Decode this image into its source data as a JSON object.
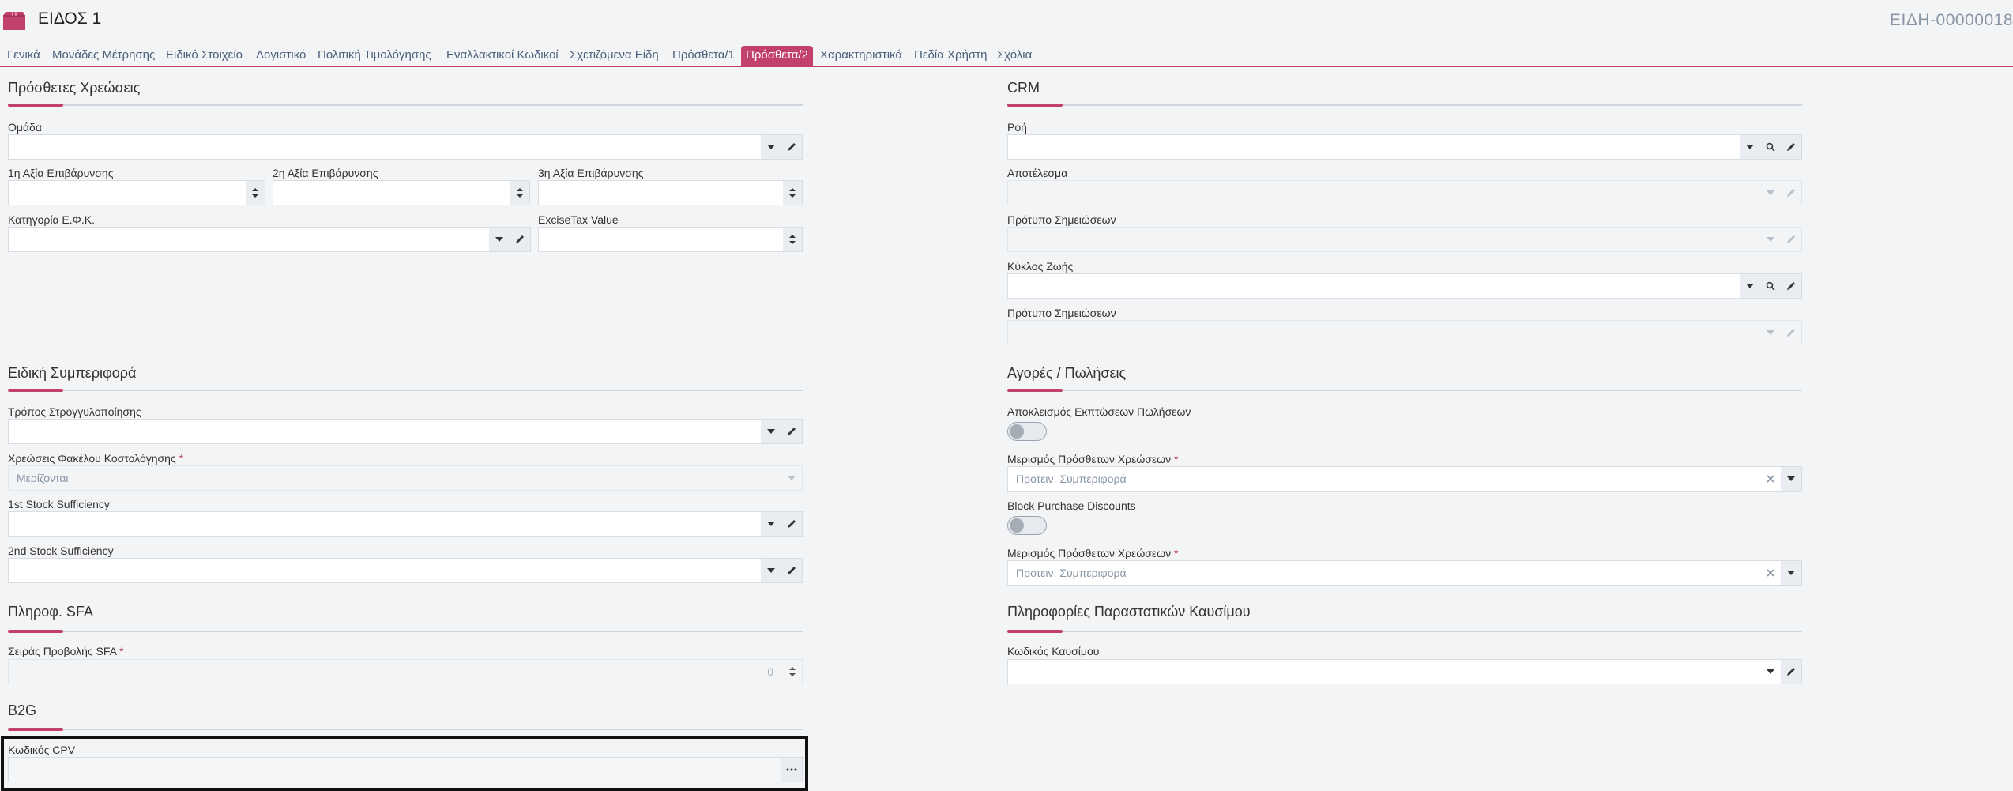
{
  "header": {
    "title": "ΕΙΔΟΣ 1",
    "code": "ΕΙΔΗ-00000018",
    "icon": "box-icon",
    "accent_color": "#c2416c"
  },
  "tabs": [
    {
      "label": "Γενικά",
      "active": false
    },
    {
      "label": "Μονάδες Μέτρησης",
      "active": false
    },
    {
      "label": "Ειδικό Στοιχείο",
      "active": false
    },
    {
      "label": "Λογιστικό",
      "active": false
    },
    {
      "label": "Πολιτική Τιμολόγησης",
      "active": false
    },
    {
      "label": "Εναλλακτικοί Κωδικοί",
      "active": false
    },
    {
      "label": "Σχετιζόμενα Είδη",
      "active": false
    },
    {
      "label": "Πρόσθετα/1",
      "active": false
    },
    {
      "label": "Πρόσθετα/2",
      "active": true
    },
    {
      "label": "Χαρακτηριστικά",
      "active": false
    },
    {
      "label": "Πεδία Χρήστη",
      "active": false
    },
    {
      "label": "Σχόλια",
      "active": false
    }
  ],
  "sections": {
    "extra_charges": {
      "title": "Πρόσθετες Χρεώσεις",
      "group_label": "Ομάδα",
      "burden1_label": "1η Αξία Επιβάρυνσης",
      "burden2_label": "2η Αξία Επιβάρυνσης",
      "burden3_label": "3η Αξία Επιβάρυνσης",
      "efk_label": "Κατηγορία Ε.Φ.Κ.",
      "excise_label": "ExciseTax Value"
    },
    "crm": {
      "title": "CRM",
      "flow_label": "Ροή",
      "result_label": "Αποτέλεσμα",
      "notes_template1_label": "Πρότυπο Σημειώσεων",
      "lifecycle_label": "Κύκλος Ζωής",
      "notes_template2_label": "Πρότυπο Σημειώσεων"
    },
    "special": {
      "title": "Ειδική Συμπεριφορά",
      "rounding_label": "Τρόπος Στρογγυλοποίησης",
      "costing_label": "Χρεώσεις Φακέλου Κοστολόγησης",
      "costing_value": "Μερίζονται",
      "stock1_label": "1st Stock Sufficiency",
      "stock2_label": "2nd Stock Sufficiency"
    },
    "purchases": {
      "title": "Αγορές / Πωλήσεις",
      "exclude_label": "Αποκλεισμός Εκπτώσεων Πωλήσεων",
      "exclude_on": false,
      "split1_label": "Μερισμός Πρόσθετων Χρεώσεων",
      "split1_value": "Προτειν. Συμπεριφορά",
      "block_label": "Block Purchase Discounts",
      "block_on": false,
      "split2_label": "Μερισμός Πρόσθετων Χρεώσεων",
      "split2_value": "Προτειν. Συμπεριφορά"
    },
    "sfa": {
      "title": "Πληροφ. SFA",
      "order_label": "Σειράς Προβολής SFA",
      "order_value": "0"
    },
    "fuel": {
      "title": "Πληροφορίες Παραστατικών Καυσίμου",
      "code_label": "Κωδικός Καυσίμου"
    },
    "b2g": {
      "title": "B2G",
      "cpv_label": "Κωδικός CPV"
    }
  },
  "required_mark": "*"
}
